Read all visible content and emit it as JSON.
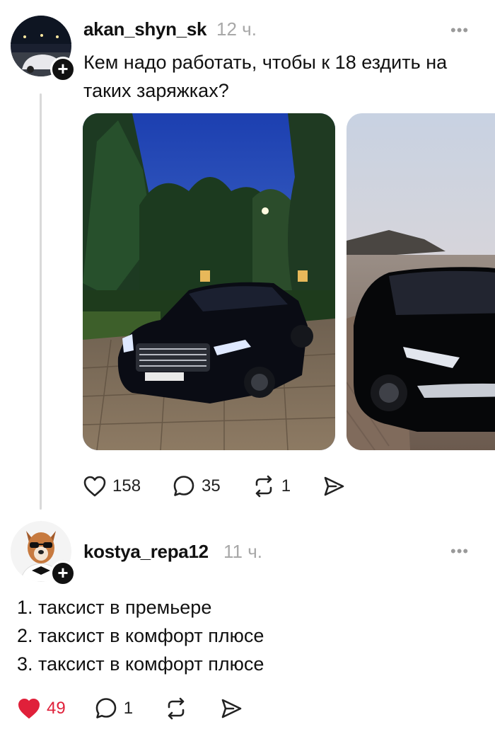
{
  "post1": {
    "username": "akan_shyn_sk",
    "time": "12 ч.",
    "more": "•••",
    "text": "Кем надо работать, чтобы к 18 ездить на таких заряжках?",
    "images": [
      "mercedes-s-class-photo",
      "toyota-camry-photo"
    ],
    "likes": "158",
    "comments": "35",
    "reposts": "1",
    "icons": {
      "like": "heart-icon",
      "comment": "comment-icon",
      "repost": "repost-icon",
      "share": "share-icon"
    }
  },
  "post2": {
    "username": "kostya_repa12",
    "time": "11 ч.",
    "more": "•••",
    "lines": [
      "1. таксист в премьере",
      "2. таксист в комфорт плюсе",
      "3. таксист в комфорт плюсе"
    ],
    "likes": "49",
    "comments": "1",
    "liked": true,
    "like_color": "#e0203a"
  },
  "plus_sign": "+"
}
